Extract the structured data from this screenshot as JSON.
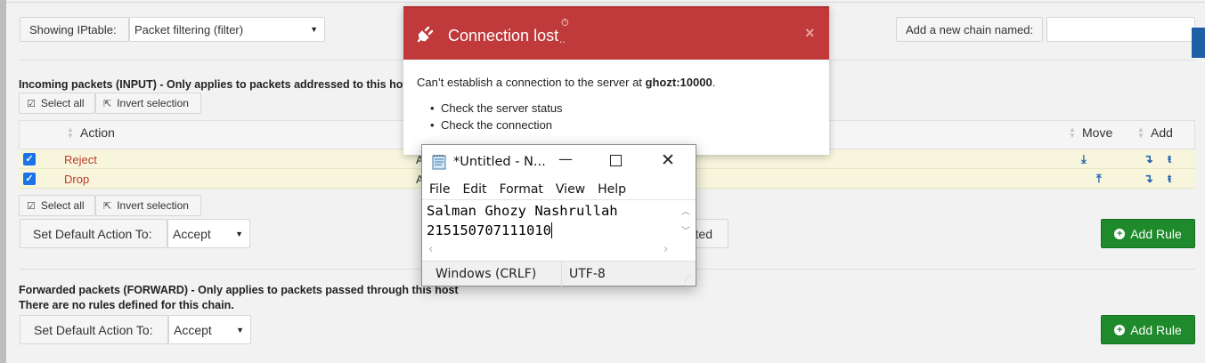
{
  "toolbar": {
    "showing_label": "Showing IPtable:",
    "table_select": "Packet filtering (filter)",
    "add_chain_label": "Add a new chain named:",
    "add_chain_value": ""
  },
  "input_section": {
    "title": "Incoming packets (INPUT) - Only applies to packets addressed to this host",
    "select_all": "Select all",
    "invert_selection": "Invert selection",
    "columns": {
      "action": "Action",
      "move": "Move",
      "add": "Add"
    },
    "rows": [
      {
        "action": "Reject",
        "condition_partial": "A",
        "checked": true
      },
      {
        "action": "Drop",
        "condition_partial": "A",
        "checked": true
      }
    ],
    "set_default_label": "Set Default Action To:",
    "default_action": "Accept",
    "partial_button": "ted",
    "add_rule": "Add Rule"
  },
  "forward_section": {
    "title": "Forwarded packets (FORWARD) - Only applies to packets passed through this host",
    "empty_text": "There are no rules defined for this chain.",
    "set_default_label": "Set Default Action To:",
    "default_action": "Accept",
    "add_rule": "Add Rule"
  },
  "modal": {
    "title": "Connection lost",
    "title_suffix": "..",
    "message_prefix": "Can’t establish a connection to the server at ",
    "server": "ghozt:10000",
    "message_suffix": ".",
    "bullets": [
      "Check the server status",
      "Check the connection"
    ],
    "close": "×"
  },
  "notepad": {
    "title": "*Untitled - N...",
    "menu": [
      "File",
      "Edit",
      "Format",
      "View",
      "Help"
    ],
    "text_line1": "Salman Ghozy Nashrullah",
    "text_line2": "215150707111010",
    "status_eol": "Windows (CRLF)",
    "status_encoding": "UTF-8"
  },
  "colors": {
    "modal_header": "#c0393b",
    "add_rule_green": "#1e8a2c",
    "checkbox_blue": "#1a73e8",
    "row_highlight": "#f7f6dc",
    "action_red": "#c0392b"
  }
}
